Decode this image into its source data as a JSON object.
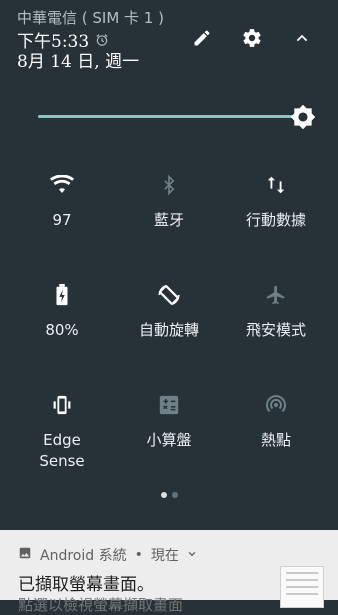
{
  "status": {
    "carrier": "中華電信 ( SIM 卡 1 )",
    "time": "下午5:33",
    "date": "8月 14 日, 週一"
  },
  "brightness": {
    "level": 1.0
  },
  "tiles": [
    {
      "label": "97",
      "icon": "wifi-icon"
    },
    {
      "label": "藍牙",
      "icon": "bluetooth-icon"
    },
    {
      "label": "行動數據",
      "icon": "mobile-data-icon"
    },
    {
      "label": "80%",
      "icon": "battery-icon"
    },
    {
      "label": "自動旋轉",
      "icon": "auto-rotate-icon"
    },
    {
      "label": "飛安模式",
      "icon": "airplane-mode-icon"
    },
    {
      "label": "Edge\nSense",
      "icon": "edge-sense-icon"
    },
    {
      "label": "小算盤",
      "icon": "calculator-icon"
    },
    {
      "label": "熱點",
      "icon": "hotspot-icon"
    }
  ],
  "notification": {
    "app": "Android 系統",
    "separator": "•",
    "when": "現在",
    "title": "已擷取螢幕畫面。",
    "subtitle": "點選以檢視螢幕擷取畫面"
  }
}
